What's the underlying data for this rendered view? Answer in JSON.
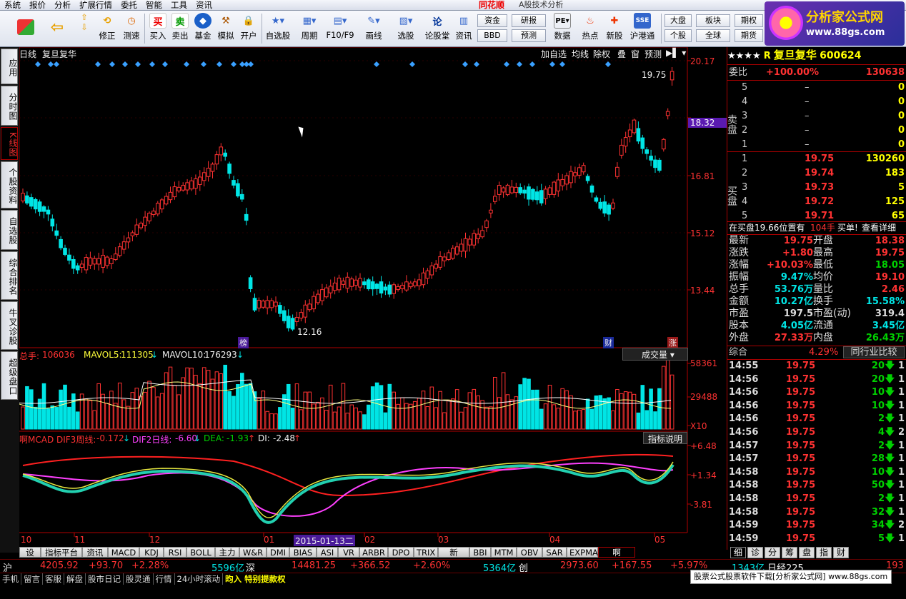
{
  "menu": {
    "items": [
      "系统",
      "报价",
      "分析",
      "扩展行情",
      "委托",
      "智能",
      "工具",
      "资讯"
    ],
    "app_title": "同花顺",
    "app_subtitle": "A股技术分析"
  },
  "toolbar": {
    "buttons": [
      "修正",
      "测速",
      "买入",
      "卖出",
      "基金",
      "模拟",
      "开户",
      "自选股",
      "周期",
      "F10/F9",
      "画线",
      "选股",
      "论股堂",
      "资讯",
      "数据",
      "热点",
      "新股",
      "沪港通",
      "个股",
      "全球",
      "期货"
    ],
    "small_buttons": {
      "zijin": "资金",
      "bbd": "BBD",
      "yanbao": "研报",
      "yuce": "预测",
      "dapan": "大盘",
      "bankuai": "板块",
      "qiquan": "期权",
      "geGu": "个股",
      "quanqiu": "全球",
      "qihuo": "期货"
    }
  },
  "logo": {
    "title": "分析家公式网",
    "url": "www.88gs.com"
  },
  "sidebar": {
    "items": [
      "应用",
      "分时图",
      "K线图",
      "个股资料",
      "自选股",
      "综合排名",
      "牛叉诊股",
      "超级盘口"
    ],
    "active": 2
  },
  "chart": {
    "header": {
      "period": "日线",
      "name": "复旦复华"
    },
    "top_actions": [
      "加自选",
      "均线",
      "除权",
      "叠",
      "窗",
      "预测"
    ],
    "price_labels": [
      "20.17",
      "18.32",
      "16.81",
      "15.12",
      "13.44"
    ],
    "highlight_price": "18.32",
    "high_marker": "19.75",
    "low_marker": "12.16",
    "markers": {
      "bang": "榜",
      "cai": "财",
      "zhang": "涨"
    },
    "volume_legend": {
      "label": "总手:",
      "total": "106036",
      "mavol5_label": "MAVOL5:",
      "mavol5": "111305",
      "mavol10_label": "MAVOL10:",
      "mavol10": "176293"
    },
    "volume_dropdown": "成交量",
    "volume_axis": [
      "58361",
      "29488",
      "X10"
    ],
    "macd_legend": {
      "name": "啊MCAD",
      "dif3_label": "DIF3周线:",
      "dif3": "-0.172",
      "dif2_label": "DIF2日线:",
      "dif2": "-6.60",
      "dea_label": "DEA:",
      "dea": "-1.93",
      "di_label": "DI:",
      "di": "-2.48"
    },
    "macd_help": "指标说明",
    "macd_axis": [
      "+6.48",
      "+1.34",
      "-3.81"
    ],
    "date_labels": [
      "10",
      "11",
      "12",
      "01",
      "02",
      "03",
      "04",
      "05"
    ],
    "date_highlight": "2015-01-13二",
    "indicator_tabs": [
      "设置",
      "指标平台",
      "资讯",
      "MACD",
      "KDJ",
      "RSI",
      "BOLL",
      "主力",
      "W&R",
      "DMI",
      "BIAS",
      "ASI",
      "VR",
      "ARBR",
      "DPO",
      "TRIX",
      "新DMA",
      "BBI",
      "MTM",
      "OBV",
      "SAR",
      "EXPMA",
      "啊MCAD"
    ]
  },
  "quote": {
    "stars": "★★★★",
    "flag": "R",
    "name": "复旦复华",
    "code": "600624",
    "weibi_label": "委比",
    "weibi": "+100.00%",
    "weibi_vol": "130638",
    "sell_label": "卖盘",
    "buy_label": "买盘",
    "sell": [
      {
        "n": "5",
        "p": "–",
        "v": "0"
      },
      {
        "n": "4",
        "p": "–",
        "v": "0"
      },
      {
        "n": "3",
        "p": "–",
        "v": "0"
      },
      {
        "n": "2",
        "p": "–",
        "v": "0"
      },
      {
        "n": "1",
        "p": "–",
        "v": "0"
      }
    ],
    "buy": [
      {
        "n": "1",
        "p": "19.75",
        "v": "130260"
      },
      {
        "n": "2",
        "p": "19.74",
        "v": "183"
      },
      {
        "n": "3",
        "p": "19.73",
        "v": "5"
      },
      {
        "n": "4",
        "p": "19.72",
        "v": "125"
      },
      {
        "n": "5",
        "p": "19.71",
        "v": "65"
      }
    ],
    "notice_left": "在买盘19.66位置有",
    "notice_qty": "104手",
    "notice_right": "买单!",
    "notice_link": "查看详细",
    "stats": [
      {
        "k1": "最新",
        "v1": "19.75",
        "k2": "开盘",
        "v2": "18.38"
      },
      {
        "k1": "涨跌",
        "v1": "+1.80",
        "k2": "最高",
        "v2": "19.75"
      },
      {
        "k1": "涨幅",
        "v1": "+10.03%",
        "k2": "最低",
        "v2": "18.05"
      },
      {
        "k1": "振幅",
        "v1": "9.47%",
        "k2": "均价",
        "v2": "19.10"
      },
      {
        "k1": "总手",
        "v1": "53.76万",
        "k2": "量比",
        "v2": "2.46"
      },
      {
        "k1": "金额",
        "v1": "10.27亿",
        "k2": "换手",
        "v2": "15.58%"
      },
      {
        "k1": "市盈",
        "v1": "197.5",
        "k2": "市盈(动)",
        "v2": "319.4"
      },
      {
        "k1": "股本",
        "v1": "4.05亿",
        "k2": "流通",
        "v2": "3.45亿"
      },
      {
        "k1": "外盘",
        "v1": "27.33万",
        "k2": "内盘",
        "v2": "26.43万"
      }
    ],
    "zonghe_label": "综合",
    "zonghe": "4.29%",
    "industry_btn": "同行业比较",
    "ticks": [
      {
        "t": "14:55",
        "p": "19.75",
        "v": "20",
        "n": "1"
      },
      {
        "t": "14:56",
        "p": "19.75",
        "v": "20",
        "n": "1"
      },
      {
        "t": "14:56",
        "p": "19.75",
        "v": "10",
        "n": "1"
      },
      {
        "t": "14:56",
        "p": "19.75",
        "v": "10",
        "n": "1"
      },
      {
        "t": "14:56",
        "p": "19.75",
        "v": "2",
        "n": "1"
      },
      {
        "t": "14:56",
        "p": "19.75",
        "v": "4",
        "n": "2"
      },
      {
        "t": "14:57",
        "p": "19.75",
        "v": "2",
        "n": "1"
      },
      {
        "t": "14:57",
        "p": "19.75",
        "v": "28",
        "n": "1"
      },
      {
        "t": "14:58",
        "p": "19.75",
        "v": "10",
        "n": "1"
      },
      {
        "t": "14:58",
        "p": "19.75",
        "v": "50",
        "n": "1"
      },
      {
        "t": "14:58",
        "p": "19.75",
        "v": "2",
        "n": "1"
      },
      {
        "t": "14:58",
        "p": "19.75",
        "v": "32",
        "n": "1"
      },
      {
        "t": "14:59",
        "p": "19.75",
        "v": "34",
        "n": "2"
      },
      {
        "t": "14:59",
        "p": "19.75",
        "v": "5",
        "n": "1"
      }
    ],
    "bottom_tabs": [
      "细",
      "诊",
      "分",
      "筹",
      "盘",
      "指",
      "财"
    ]
  },
  "indexbar": {
    "sh_label": "沪",
    "sh": "4205.92",
    "sh_chg": "+93.70",
    "sh_pct": "+2.28%",
    "sh_amt": "5596亿",
    "sz_label": "深",
    "sz": "14481.25",
    "sz_chg": "+366.52",
    "sz_pct": "+2.60%",
    "sz_amt": "5364亿",
    "cy_label": "创",
    "cy": "2973.60",
    "cy_chg": "+167.55",
    "cy_pct": "+5.97%",
    "cy_amt": "1343亿",
    "rj_label": "日经225",
    "rj": "193"
  },
  "statusbar": {
    "items": [
      "手机",
      "留言",
      "客服",
      "解盘",
      "股市日记",
      "股灵通",
      "行情",
      "24小时滚动"
    ],
    "ticker": "昀入 特别提款权",
    "ad": "股票公式股票软件下载[分析家公式网] www.88gs.com"
  }
}
